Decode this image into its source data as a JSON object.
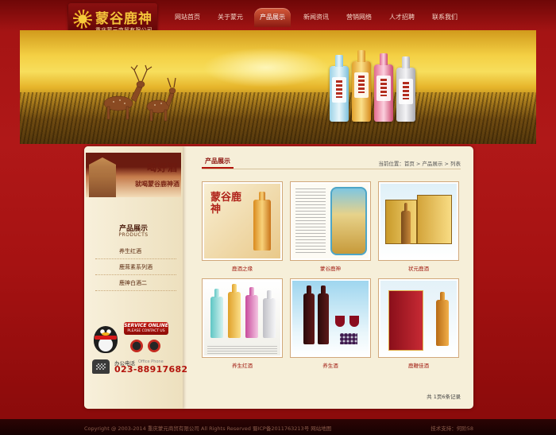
{
  "site": {
    "logo_title": "蒙谷鹿神",
    "logo_subtitle": "重庆蒙元商贸有限公司"
  },
  "nav": {
    "items": [
      {
        "label": "网站首页"
      },
      {
        "label": "关于蒙元"
      },
      {
        "label": "产品展示",
        "active": true
      },
      {
        "label": "新闻资讯"
      },
      {
        "label": "营销网络"
      },
      {
        "label": "人才招聘"
      },
      {
        "label": "联系我们"
      }
    ]
  },
  "sidebar": {
    "slogan_line1": "喝好酒",
    "slogan_line2": "就喝蒙谷鹿神酒",
    "section_title": "产品展示",
    "section_title_en": "PRODUCTS",
    "items": [
      {
        "label": "养生红酒"
      },
      {
        "label": "鹿茸素系列酒"
      },
      {
        "label": "鹿神白酒二"
      }
    ],
    "service_badge_line1": "SERVICE ONLINE",
    "service_badge_line2": "PLEASE CONTACT US",
    "phone_label": "办公电话",
    "phone_label_en": "Office Phone",
    "phone_number": "023-88917682"
  },
  "main": {
    "title": "产品展示",
    "breadcrumb": "当前位置：首页 > 产品展示 > 列表",
    "products": [
      {
        "name": "鹿酒之缘"
      },
      {
        "name": "蒙谷鹿神"
      },
      {
        "name": "状元鹿酒"
      },
      {
        "name": "养生红酒"
      },
      {
        "name": "养生酒"
      },
      {
        "name": "鹿鞭佳酒"
      }
    ],
    "pager": "共 1页6条记录"
  },
  "footer": {
    "left": "Copyright @ 2003-2014 重庆蒙元商贸有限公司  All Rights Reserved    蜀ICP备2011763213号    网站地图",
    "right": "技术支持：何阶58"
  },
  "colors": {
    "brand_red": "#b3140c",
    "gold": "#f3c23a",
    "panel_bg": "#f6efd9"
  }
}
